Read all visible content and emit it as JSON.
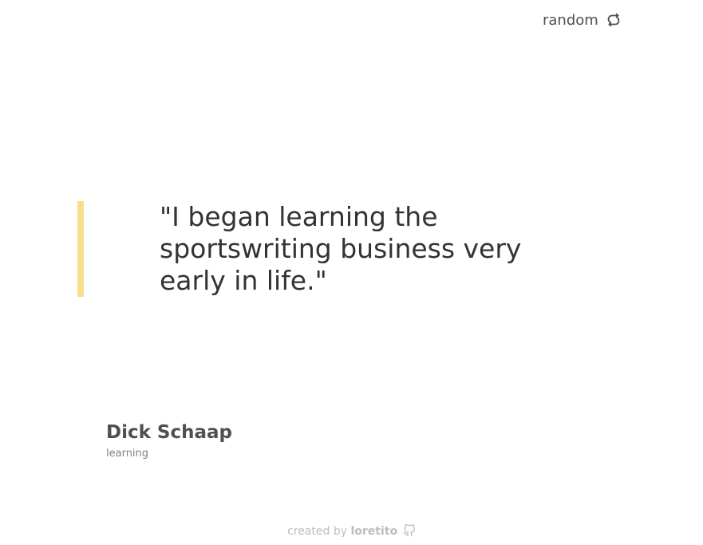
{
  "header": {
    "random_label": "random",
    "random_icon": "refresh-icon"
  },
  "quote": {
    "text": "\"I began learning the sportswriting business very early in life.\"",
    "accent_color": "#f7df8e"
  },
  "author": {
    "name": "Dick Schaap",
    "genre": "learning"
  },
  "footer": {
    "prefix": "created by",
    "creator": "loretito",
    "icon": "github-icon"
  }
}
